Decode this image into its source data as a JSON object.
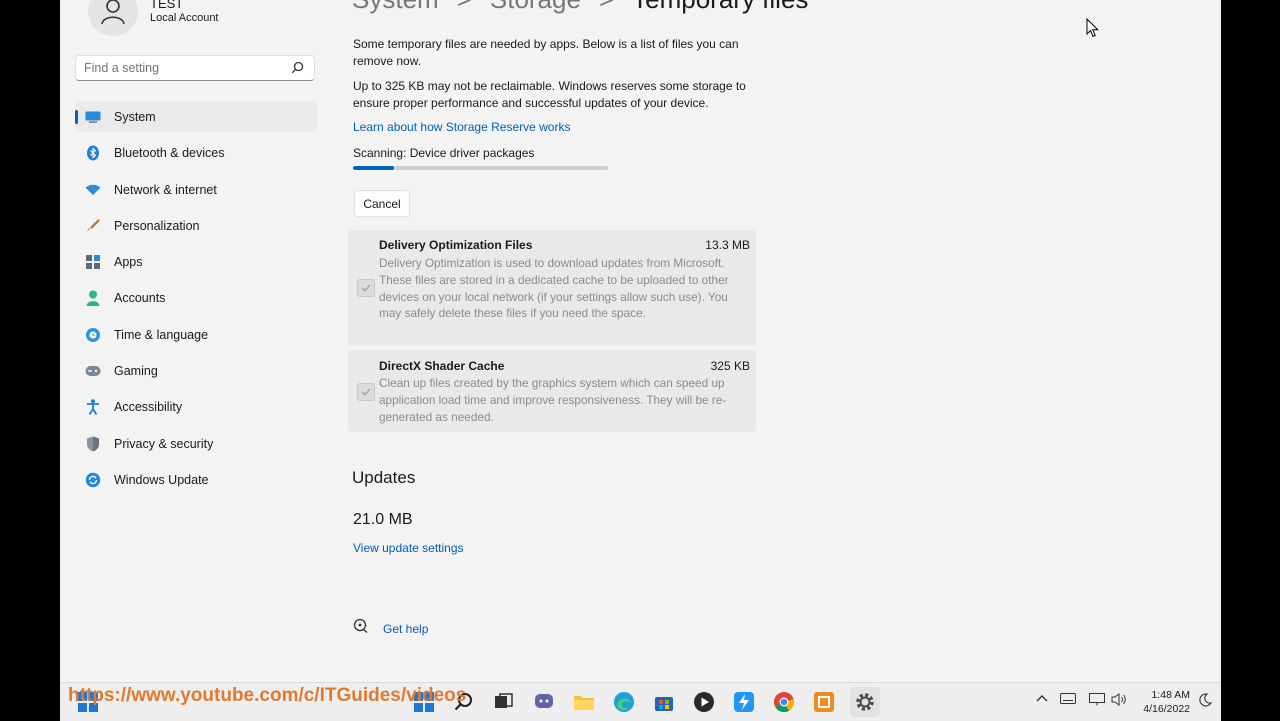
{
  "account": {
    "name": "TEST",
    "type": "Local Account"
  },
  "search": {
    "placeholder": "Find a setting"
  },
  "nav": {
    "items": [
      {
        "label": "System"
      },
      {
        "label": "Bluetooth & devices"
      },
      {
        "label": "Network & internet"
      },
      {
        "label": "Personalization"
      },
      {
        "label": "Apps"
      },
      {
        "label": "Accounts"
      },
      {
        "label": "Time & language"
      },
      {
        "label": "Gaming"
      },
      {
        "label": "Accessibility"
      },
      {
        "label": "Privacy & security"
      },
      {
        "label": "Windows Update"
      }
    ],
    "selected": "System"
  },
  "breadcrumb": {
    "items": [
      "System",
      "Storage",
      "Temporary files"
    ],
    "separator": ">"
  },
  "main": {
    "intro": "Some temporary files are needed by apps. Below is a list of files you can remove now.",
    "reserve_note": "Up to 325 KB may not be reclaimable. Windows reserves some storage to ensure proper performance and successful updates of your device.",
    "reserve_link": "Learn about how Storage Reserve works",
    "scanning": "Scanning: Device driver packages",
    "scan_progress": 0.16,
    "cancel_label": "Cancel",
    "files": [
      {
        "title": "Delivery Optimization Files",
        "size": "13.3 MB",
        "description": "Delivery Optimization is used to download updates from Microsoft. These files are stored in a dedicated cache to be uploaded to other devices on your local network (if your settings allow such use). You may safely delete these files if you need the space.",
        "checked": true
      },
      {
        "title": "DirectX Shader Cache",
        "size": "325 KB",
        "description": "Clean up files created by the graphics system which can speed up application load time and improve responsiveness. They will be re-generated as needed.",
        "checked": true
      }
    ],
    "updates_heading": "Updates",
    "updates_size": "21.0 MB",
    "updates_link": "View update settings",
    "help_link": "Get help"
  },
  "taskbar": {
    "time": "1:48 AM",
    "date": "4/16/2022",
    "watermark": "https://www.youtube.com/c/ITGuides/videos",
    "colors": {
      "accent": "#0067c0",
      "watermark": "#e07a2e"
    }
  }
}
